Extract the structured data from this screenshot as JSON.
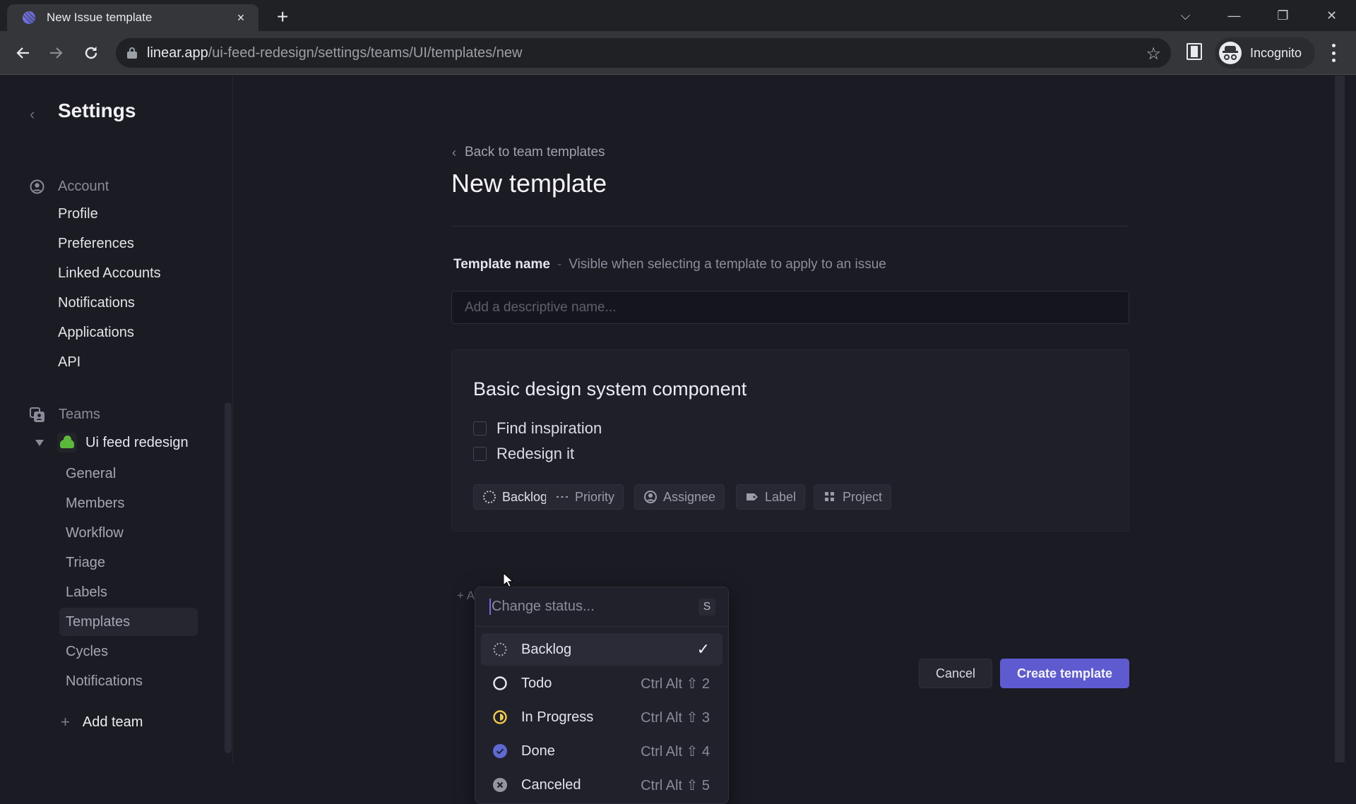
{
  "browser": {
    "tab_title": "New Issue template",
    "tab_close": "×",
    "new_tab": "+",
    "url_host": "linear.app",
    "url_path": "/ui-feed-redesign/settings/teams/UI/templates/new",
    "profile_label": "Incognito",
    "window_controls": {
      "tab_search": "⌵",
      "minimize": "—",
      "restore": "❐",
      "close": "✕"
    }
  },
  "sidebar": {
    "title": "Settings",
    "account_section": "Account",
    "account_items": [
      "Profile",
      "Preferences",
      "Linked Accounts",
      "Notifications",
      "Applications",
      "API"
    ],
    "teams_section": "Teams",
    "team_name": "Ui feed redesign",
    "team_items": [
      "General",
      "Members",
      "Workflow",
      "Triage",
      "Labels",
      "Templates",
      "Cycles",
      "Notifications"
    ],
    "active_team_item": "Templates",
    "add_team": "Add team"
  },
  "main": {
    "back_link": "Back to team templates",
    "title": "New template",
    "field_label": "Template name",
    "field_separator": "-",
    "field_hint": "Visible when selecting a template to apply to an issue",
    "name_input": {
      "value": "",
      "placeholder": "Add a descriptive name..."
    },
    "issue": {
      "title": "Basic design system component",
      "checklist": [
        {
          "label": "Find inspiration",
          "checked": false
        },
        {
          "label": "Redesign it",
          "checked": false
        }
      ]
    },
    "properties": {
      "status": "Backlog",
      "priority": "Priority",
      "assignee": "Assignee",
      "label": "Label",
      "project": "Project"
    },
    "add_link_partial": "+ A",
    "cancel": "Cancel",
    "create": "Create template"
  },
  "status_menu": {
    "placeholder": "Change status...",
    "shortcut_key": "S",
    "items": [
      {
        "label": "Backlog",
        "shortcut": "",
        "selected": true,
        "icon": "backlog-icon"
      },
      {
        "label": "Todo",
        "shortcut": "Ctrl Alt ⇧ 2",
        "selected": false,
        "icon": "todo-icon"
      },
      {
        "label": "In Progress",
        "shortcut": "Ctrl Alt ⇧ 3",
        "selected": false,
        "icon": "in-progress-icon"
      },
      {
        "label": "Done",
        "shortcut": "Ctrl Alt ⇧ 4",
        "selected": false,
        "icon": "done-icon"
      },
      {
        "label": "Canceled",
        "shortcut": "Ctrl Alt ⇧ 5",
        "selected": false,
        "icon": "canceled-icon"
      }
    ],
    "check_glyph": "✓"
  },
  "colors": {
    "accent": "#5e5bd1",
    "in_progress": "#f2c94c",
    "done": "#5e6ad2",
    "canceled": "#95959f",
    "team_icon": "#5cb83a"
  }
}
